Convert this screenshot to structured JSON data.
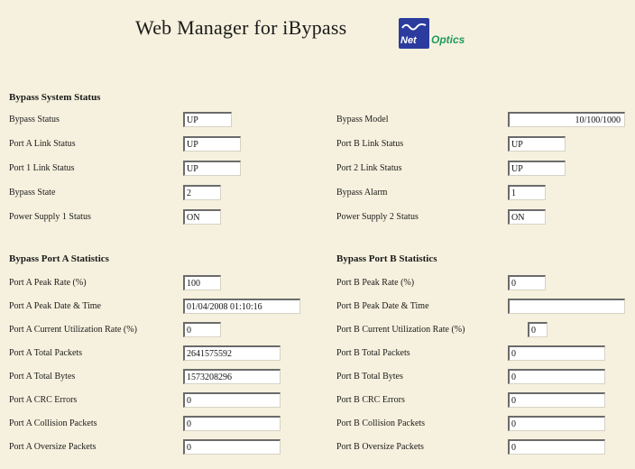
{
  "header": {
    "title": "Web Manager for iBypass",
    "logo_net": "Net",
    "logo_optics": "Optics"
  },
  "system_status": {
    "section_title": "Bypass System Status",
    "bypass_status": {
      "label": "Bypass Status",
      "value": "UP"
    },
    "port_a_link": {
      "label": "Port A Link Status",
      "value": "UP"
    },
    "port_1_link": {
      "label": "Port 1 Link Status",
      "value": "UP"
    },
    "bypass_state": {
      "label": "Bypass State",
      "value": "2"
    },
    "power_supply_1": {
      "label": "Power Supply 1 Status",
      "value": "ON"
    },
    "bypass_model": {
      "label": "Bypass Model",
      "value": "10/100/1000"
    },
    "port_b_link": {
      "label": "Port B Link Status",
      "value": "UP"
    },
    "port_2_link": {
      "label": "Port 2 Link Status",
      "value": "UP"
    },
    "bypass_alarm": {
      "label": "Bypass Alarm",
      "value": "1"
    },
    "power_supply_2": {
      "label": "Power Supply 2 Status",
      "value": "ON"
    }
  },
  "port_a": {
    "section_title": "Bypass Port A Statistics",
    "peak_rate": {
      "label": "Port A Peak Rate (%)",
      "value": "100"
    },
    "peak_date": {
      "label": "Port A Peak Date & Time",
      "value": "01/04/2008 01:10:16"
    },
    "current_util": {
      "label": "Port A Current Utilization Rate (%)",
      "value": "0"
    },
    "total_packets": {
      "label": "Port A Total Packets",
      "value": "2641575592"
    },
    "total_bytes": {
      "label": "Port A Total Bytes",
      "value": "1573208296"
    },
    "crc_errors": {
      "label": "Port A CRC Errors",
      "value": "0"
    },
    "collision_packets": {
      "label": "Port A Collision Packets",
      "value": "0"
    },
    "oversize_packets": {
      "label": "Port A Oversize Packets",
      "value": "0"
    }
  },
  "port_b": {
    "section_title": "Bypass Port B Statistics",
    "peak_rate": {
      "label": "Port B Peak Rate (%)",
      "value": "0"
    },
    "peak_date": {
      "label": "Port B Peak Date & Time",
      "value": ""
    },
    "current_util": {
      "label": "Port B Current Utilization Rate (%)",
      "value": "0"
    },
    "total_packets": {
      "label": "Port B Total Packets",
      "value": "0"
    },
    "total_bytes": {
      "label": "Port B Total Bytes",
      "value": "0"
    },
    "crc_errors": {
      "label": "Port B CRC Errors",
      "value": "0"
    },
    "collision_packets": {
      "label": "Port B Collision Packets",
      "value": "0"
    },
    "oversize_packets": {
      "label": "Port B Oversize Packets",
      "value": "0"
    }
  }
}
